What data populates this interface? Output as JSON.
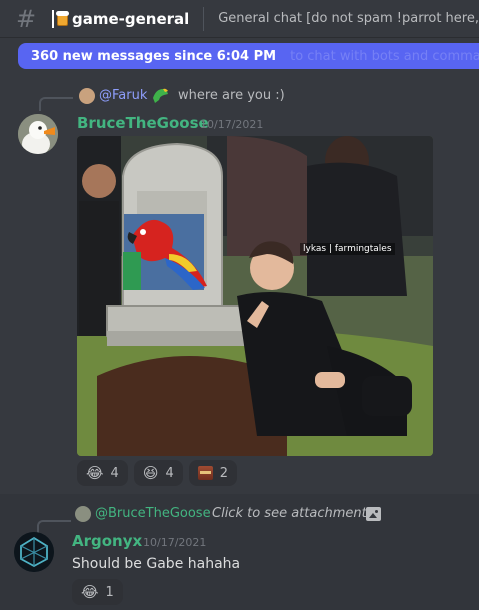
{
  "channel": {
    "name": "game-general",
    "topic": "General chat [do not spam !parrot here,"
  },
  "new_messages": {
    "label": "360 new messages since 6:04 PM",
    "ghost_text": "to chat with bots and comma"
  },
  "messages": [
    {
      "reply": {
        "author": "@Faruk",
        "text": "where are you :)"
      },
      "author": "BruceTheGoose",
      "author_color": "#43b581",
      "timestamp": "10/17/2021",
      "image_caption": "lykas | farmingtales",
      "reactions": [
        {
          "emoji": "😂",
          "count": "4"
        },
        {
          "emoji": "😆",
          "count": "4"
        },
        {
          "emoji": "custom-emoji",
          "count": "2"
        }
      ]
    },
    {
      "reply": {
        "author": "@BruceTheGoose",
        "text": "Click to see attachment"
      },
      "author": "Argonyx",
      "author_color": "#43b581",
      "timestamp": "10/17/2021",
      "text": "Should be Gabe hahaha",
      "reactions": [
        {
          "emoji": "😂",
          "count": "1"
        }
      ]
    }
  ],
  "colors": {
    "accent": "#5865f2",
    "background": "#36393f",
    "reply_name_faruk": "#8e9efc",
    "username_green": "#43b581"
  }
}
